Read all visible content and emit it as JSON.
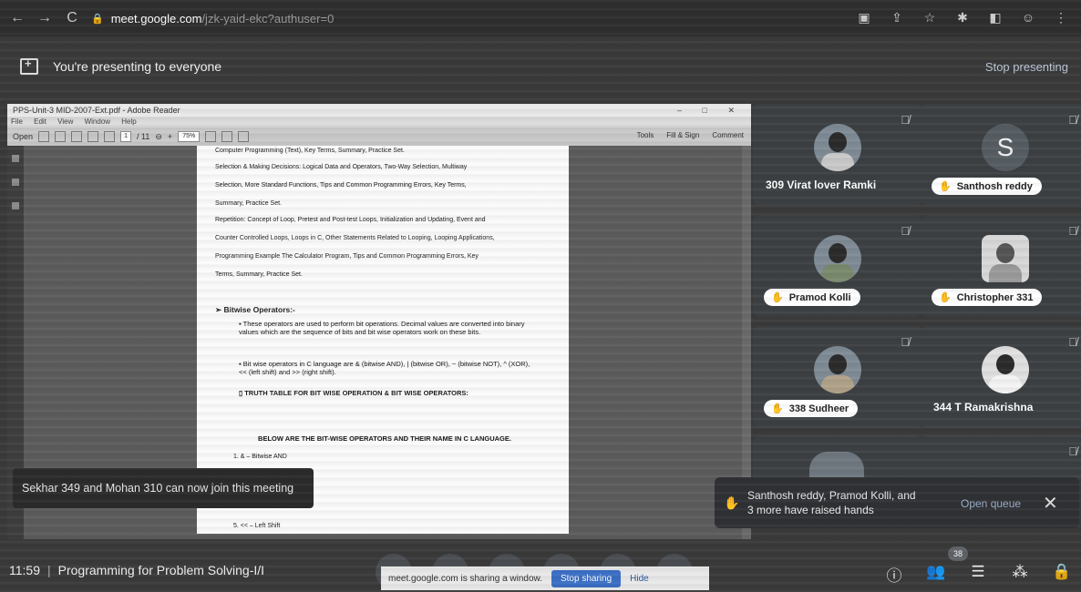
{
  "browser": {
    "url_host": "meet.google.com",
    "url_path": "/jzk-yaid-ekc?authuser=0",
    "nav": [
      "←",
      "→",
      "C"
    ],
    "icons": [
      "cast-icon",
      "share-icon",
      "star-icon",
      "extension-icon",
      "sidepanel-icon",
      "profile-icon",
      "menu-icon"
    ]
  },
  "banner": {
    "text": "You're presenting to everyone",
    "stop_label": "Stop presenting"
  },
  "reader": {
    "title": "PPS-Unit-3 MID-2007-Ext.pdf - Adobe Reader",
    "menu": [
      "File",
      "Edit",
      "View",
      "Window",
      "Help"
    ],
    "open_label": "Open",
    "page_current": "1",
    "page_total": "/ 11",
    "zoom": "75%",
    "right_tools": [
      "Tools",
      "Fill & Sign",
      "Comment"
    ],
    "lines": [
      "Computer Programming (Text), Key Terms, Summary, Practice Set.",
      "Selection & Making Decisions: Logical Data and Operators, Two-Way Selection, Multiway",
      "Selection, More Standard Functions, Tips and Common Programming Errors, Key Terms,",
      "Summary, Practice Set.",
      "Repetition: Concept of Loop, Pretest and Post-test Loops, Initialization and Updating, Event and",
      "Counter Controlled Loops, Loops in C, Other Statements Related to Looping, Looping Applications,",
      "Programming Example The Calculator Program, Tips and Common Programming Errors, Key",
      "Terms, Summary, Practice Set."
    ],
    "heading": "Bitwise Operators:-",
    "bullets": [
      "These operators are used to perform bit operations. Decimal values are converted into binary values which are the sequence of bits and bit wise operators work on these bits.",
      "Bit wise operators in C language are & (bitwise AND), | (bitwise OR), ~ (bitwise NOT), ^ (XOR), << (left shift) and >> (right shift).",
      "TRUTH TABLE FOR BIT WISE OPERATION & BIT WISE OPERATORS:"
    ],
    "center_line": "BELOW ARE THE BIT-WISE OPERATORS AND THEIR NAME IN C LANGUAGE.",
    "list_first": "1. & – Bitwise AND",
    "list_last": "5. << – Left Shift"
  },
  "participants": [
    {
      "name": "309 Virat lover Ramki",
      "style": "plain",
      "avatar": "photo"
    },
    {
      "name": "Santhosh reddy",
      "style": "pill",
      "avatar": "letter",
      "letter": "S"
    },
    {
      "name": "Pramod Kolli",
      "style": "pill",
      "avatar": "photo"
    },
    {
      "name": "Christopher 331",
      "style": "pill",
      "avatar": "photo"
    },
    {
      "name": "338 Sudheer",
      "style": "pill",
      "avatar": "photo"
    },
    {
      "name": "344 T Ramakrishna",
      "style": "plain",
      "avatar": "photo"
    }
  ],
  "toasts": {
    "join": "Sekhar 349 and Mohan 310 can now join this meeting",
    "hands_line1": "Santhosh reddy, Pramod Kolli, and",
    "hands_line2": "3 more have raised hands",
    "open_queue": "Open queue",
    "close": "✕"
  },
  "bottom": {
    "time": "11:59",
    "separator": "|",
    "meeting_title": "Programming for Problem Solving-I/I",
    "share_text": "meet.google.com is sharing a window.",
    "stop_sharing": "Stop sharing",
    "hide": "Hide",
    "participant_count": "38"
  }
}
